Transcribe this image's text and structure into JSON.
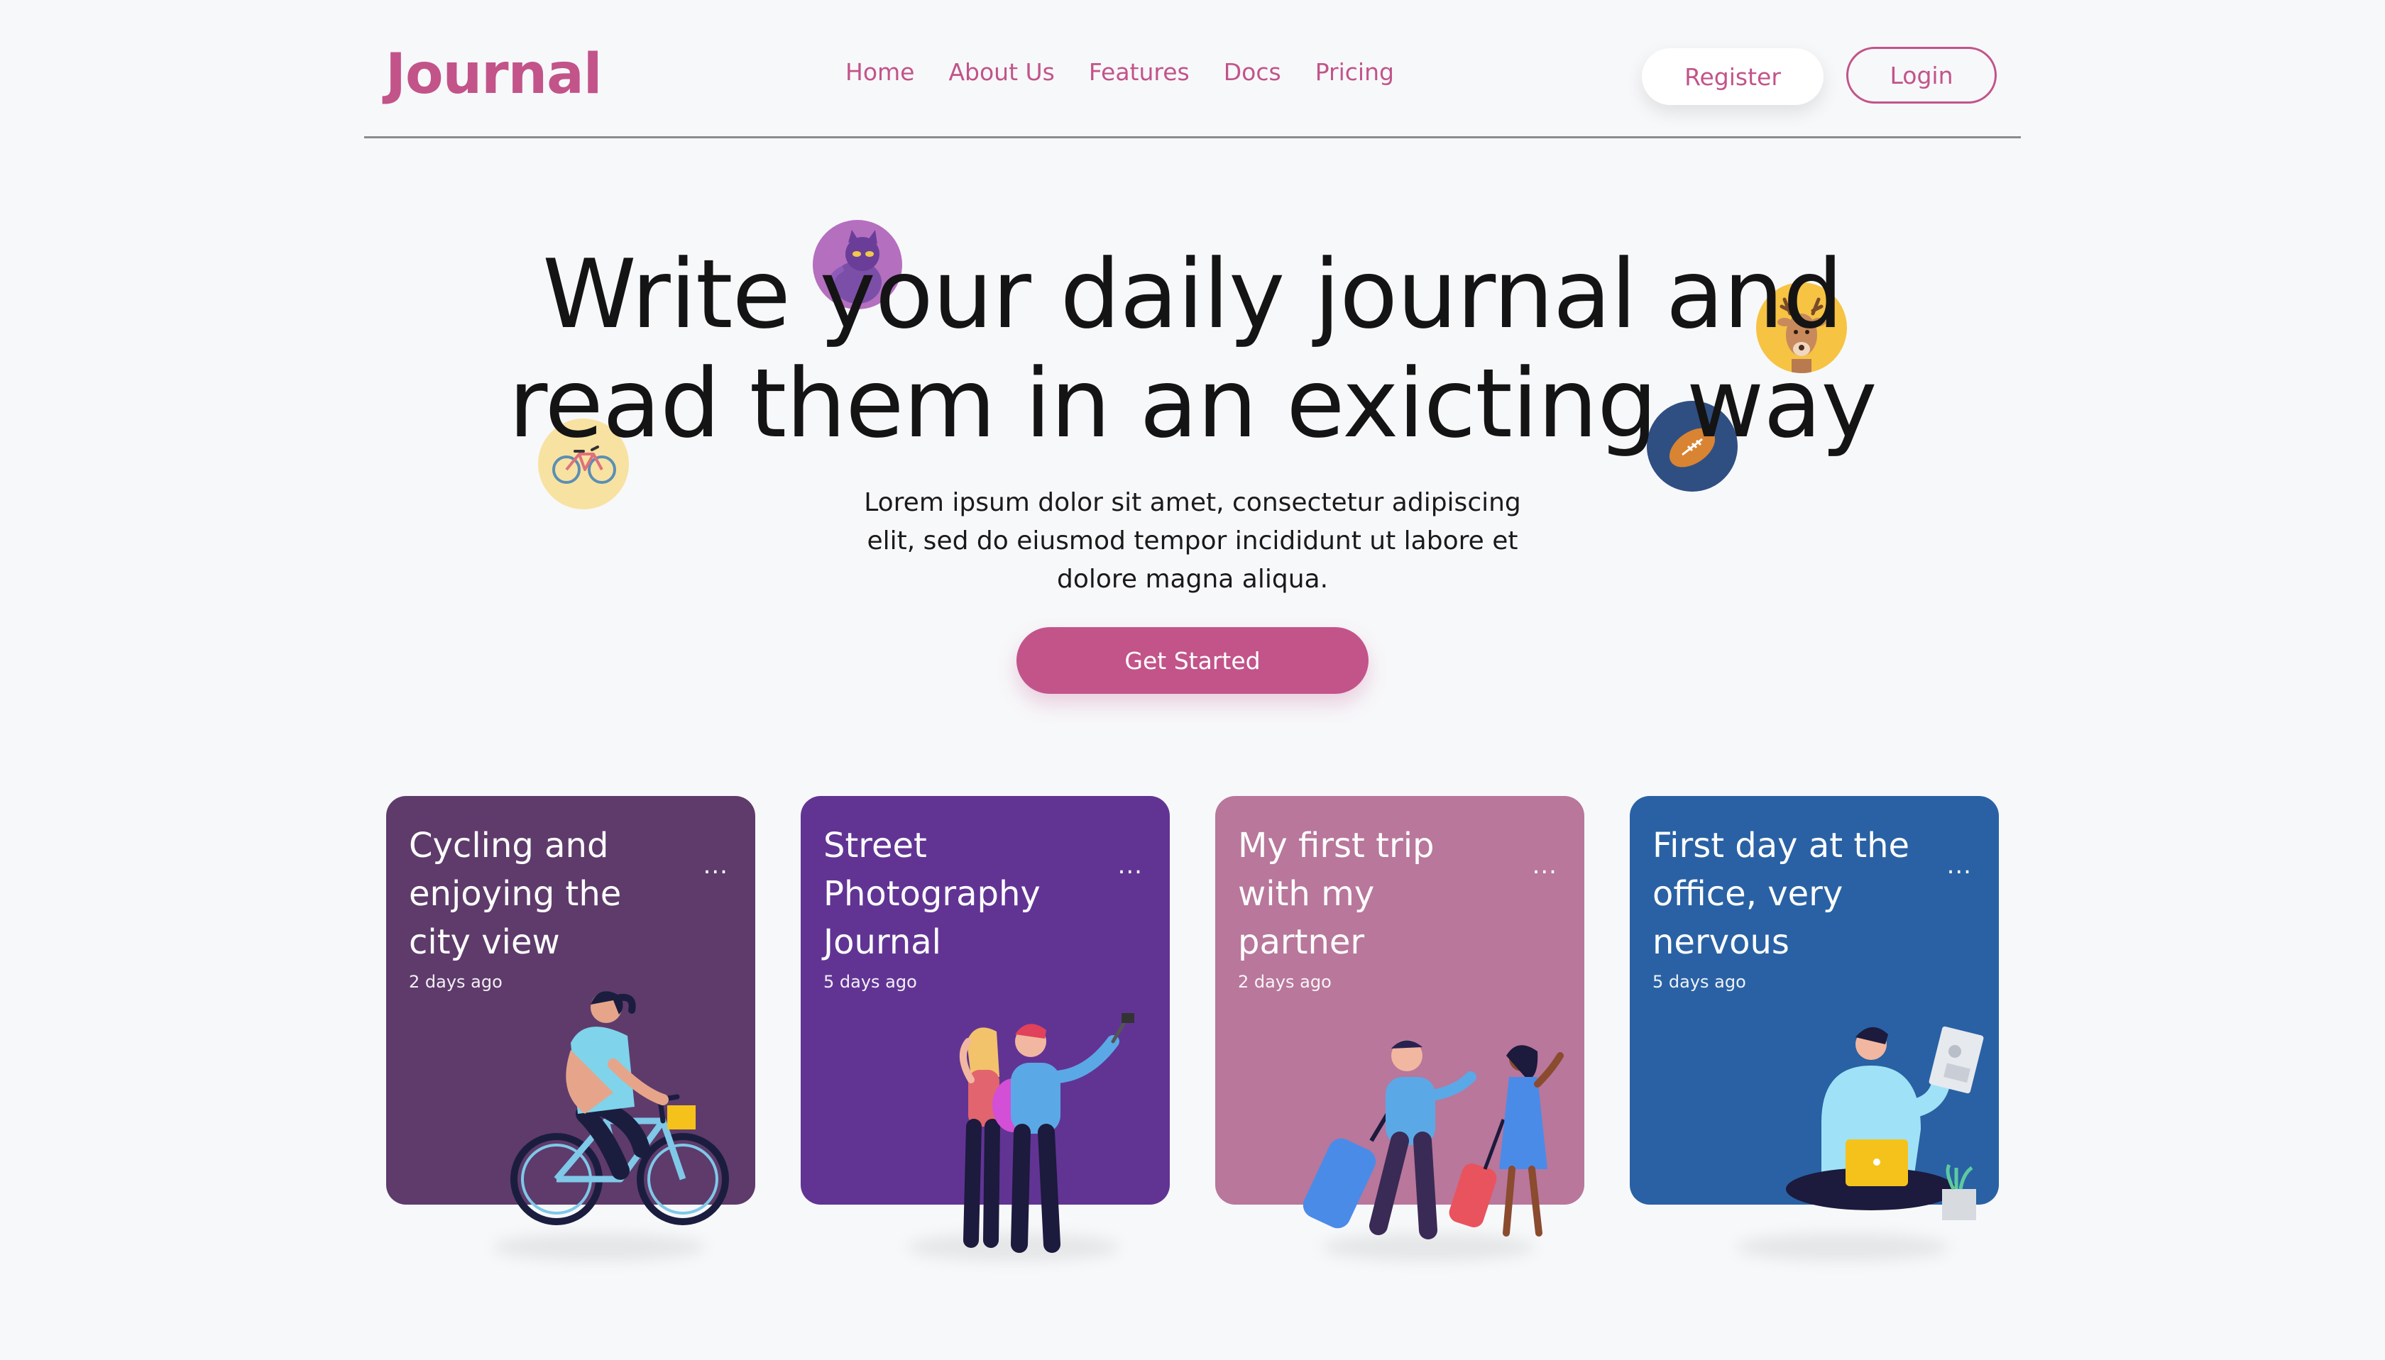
{
  "nav": {
    "logo": "Journal",
    "links": [
      "Home",
      "About Us",
      "Features",
      "Docs",
      "Pricing"
    ],
    "register_label": "Register",
    "login_label": "Login"
  },
  "hero": {
    "title_line1": "Write your daily journal and",
    "title_line2": "read them in an exicting way",
    "subtitle": "Lorem ipsum dolor sit amet, consectetur adipiscing elit, sed do eiusmod tempor incididunt ut labore et dolore magna aliqua.",
    "cta_label": "Get Started"
  },
  "cards": [
    {
      "title": "Cycling and enjoying the city view",
      "date": "2 days ago",
      "color": "#5e3b6b",
      "more": "..."
    },
    {
      "title": "Street Photography Journal",
      "date": "5 days ago",
      "color": "#613494",
      "more": "..."
    },
    {
      "title": "My first trip with my partner",
      "date": "2 days ago",
      "color": "#b8779b",
      "more": "..."
    },
    {
      "title": "First day at the office, very nervous",
      "date": "5 days ago",
      "color": "#2961a4",
      "more": "..."
    }
  ],
  "colors": {
    "accent": "#c2548a",
    "background": "#f7f8fa",
    "text": "#141414"
  },
  "icons": [
    "cat-avatar-icon",
    "deer-avatar-icon",
    "bicycle-avatar-icon",
    "football-avatar-icon"
  ]
}
